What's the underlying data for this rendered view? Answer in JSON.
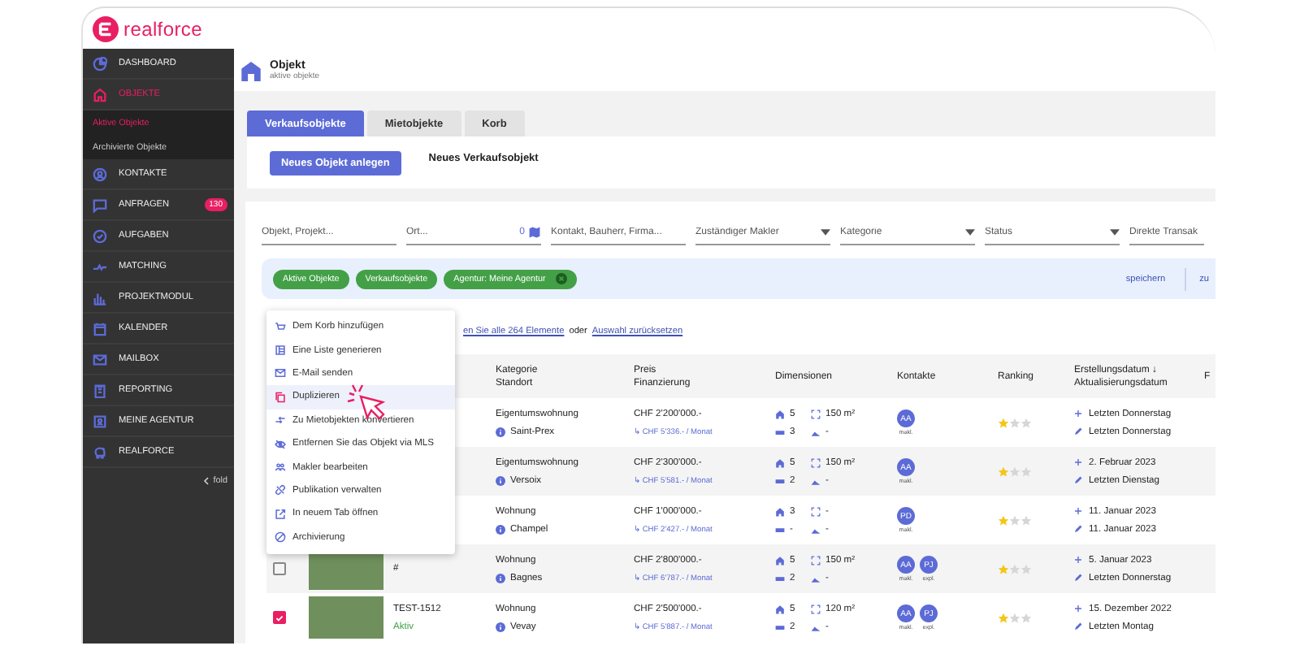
{
  "logo": {
    "text": "realforce"
  },
  "sidebar": {
    "items": [
      {
        "label": "DASHBOARD",
        "selected": false
      },
      {
        "label": "OBJEKTE",
        "selected": true,
        "children": [
          {
            "label": "Aktive Objekte",
            "selected": true
          },
          {
            "label": "Archivierte Objekte",
            "selected": false
          }
        ]
      },
      {
        "label": "KONTAKTE",
        "selected": false
      },
      {
        "label": "ANFRAGEN",
        "selected": false,
        "badge": "130"
      },
      {
        "label": "AUFGABEN",
        "selected": false
      },
      {
        "label": "MATCHING",
        "selected": false
      },
      {
        "label": "PROJEKTMODUL",
        "selected": false
      },
      {
        "label": "KALENDER",
        "selected": false
      },
      {
        "label": "MAILBOX",
        "selected": false
      },
      {
        "label": "REPORTING",
        "selected": false
      },
      {
        "label": "MEINE AGENTUR",
        "selected": false
      },
      {
        "label": "REALFORCE",
        "selected": false
      }
    ],
    "fold_label": "fold"
  },
  "header": {
    "title": "Objekt",
    "subtitle": "aktive objekte"
  },
  "tabs": [
    {
      "label": "Verkaufsobjekte",
      "selected": true
    },
    {
      "label": "Mietobjekte",
      "selected": false
    },
    {
      "label": "Korb",
      "selected": false
    }
  ],
  "create_button": "Neues Objekt anlegen",
  "create_note": "Neues Verkaufsobjekt",
  "filters": [
    {
      "kind": "text",
      "placeholder": "Objekt, Projekt..."
    },
    {
      "kind": "map",
      "placeholder": "Ort...",
      "count": "0"
    },
    {
      "kind": "text",
      "placeholder": "Kontakt, Bauherr, Firma..."
    },
    {
      "kind": "select",
      "placeholder": "Zuständiger Makler"
    },
    {
      "kind": "select",
      "placeholder": "Kategorie"
    },
    {
      "kind": "select",
      "placeholder": "Status"
    },
    {
      "kind": "text",
      "placeholder": "Direkte Transak"
    }
  ],
  "chips": [
    {
      "label": "Aktive Objekte",
      "removable": false
    },
    {
      "label": "Verkaufsobjekte",
      "removable": false
    },
    {
      "label": "Agentur: Meine Agentur",
      "removable": true
    }
  ],
  "chip_actions": [
    "speichern",
    "zu"
  ],
  "selection_note": {
    "link_1": "en Sie alle 264 Elemente",
    "text": "oder",
    "link_2": "Auswahl zurücksetzen"
  },
  "context_menu": {
    "items": [
      {
        "label": "Dem Korb hinzufügen",
        "selected": false
      },
      {
        "label": "Eine Liste generieren",
        "selected": false
      },
      {
        "label": "E-Mail senden",
        "selected": false
      },
      {
        "label": "Duplizieren",
        "selected": true
      },
      {
        "label": "Zu Mietobjekten konvertieren",
        "selected": false
      },
      {
        "label": "Entfernen Sie das Objekt via MLS",
        "selected": false
      },
      {
        "label": "Makler bearbeiten",
        "selected": false
      },
      {
        "label": "Publikation verwalten",
        "selected": false
      },
      {
        "label": "In neuem Tab öffnen",
        "selected": false
      },
      {
        "label": "Archivierung",
        "selected": false
      }
    ]
  },
  "table": {
    "columns": [
      {
        "lines": [
          "Kategorie",
          "Standort"
        ]
      },
      {
        "lines": [
          "Preis",
          "Finanzierung"
        ]
      },
      {
        "lines": [
          "Dimensionen"
        ]
      },
      {
        "lines": [
          "Kontakte"
        ]
      },
      {
        "lines": [
          "Ranking"
        ]
      },
      {
        "lines": [
          "Erstellungsdatum ↓",
          "Aktualisierungsdatum"
        ]
      },
      {
        "lines": [
          "F"
        ]
      }
    ],
    "rows": [
      {
        "kategorie": "Eigentumswohnung",
        "standort": "Saint-Prex",
        "preis": "CHF 2'200'000.-",
        "finanzierung": "↳ CHF 5'336.- / Monat",
        "rooms": "5",
        "area": "150 m²",
        "baths": "3",
        "floor": "-",
        "contacts": [
          {
            "initials": "AA",
            "role": "makl."
          }
        ],
        "stars": 1,
        "created": "Letzten Donnerstag",
        "updated": "Letzten Donnerstag"
      },
      {
        "kategorie": "Eigentumswohnung",
        "standort": "Versoix",
        "preis": "CHF 2'300'000.-",
        "finanzierung": "↳ CHF 5'581.- / Monat",
        "rooms": "5",
        "area": "150 m²",
        "baths": "2",
        "floor": "-",
        "contacts": [
          {
            "initials": "AA",
            "role": "makl."
          }
        ],
        "stars": 1,
        "created": "2. Februar 2023",
        "updated": "Letzten Dienstag"
      },
      {
        "kategorie": "Wohnung",
        "standort": "Champel",
        "preis": "CHF 1'000'000.-",
        "finanzierung": "↳ CHF 2'427.- / Monat",
        "rooms": "3",
        "area": "-",
        "baths": "-",
        "floor": "-",
        "contacts": [
          {
            "initials": "PD",
            "role": "makl."
          }
        ],
        "stars": 1,
        "created": "11. Januar 2023",
        "updated": "11. Januar 2023"
      },
      {
        "selected": false,
        "photo": true,
        "ref": "#",
        "kategorie": "Wohnung",
        "standort": "Bagnes",
        "preis": "CHF 2'800'000.-",
        "finanzierung": "↳ CHF 6'787.- / Monat",
        "rooms": "5",
        "area": "150 m²",
        "baths": "2",
        "floor": "-",
        "contacts": [
          {
            "initials": "AA",
            "role": "makl."
          },
          {
            "initials": "PJ",
            "role": "expl."
          }
        ],
        "stars": 1,
        "created": "5. Januar 2023",
        "updated": "Letzten Donnerstag"
      },
      {
        "selected": true,
        "photo": true,
        "ref": "TEST-1512",
        "status": "Aktiv",
        "kategorie": "Wohnung",
        "standort": "Vevay",
        "preis": "CHF 2'500'000.-",
        "finanzierung": "↳ CHF 5'887.- / Monat",
        "rooms": "5",
        "area": "120 m²",
        "baths": "2",
        "floor": "-",
        "contacts": [
          {
            "initials": "AA",
            "role": "makl."
          },
          {
            "initials": "PJ",
            "role": "expl."
          }
        ],
        "stars": 1,
        "created": "15. Dezember 2022",
        "updated": "Letzten Montag"
      }
    ]
  }
}
